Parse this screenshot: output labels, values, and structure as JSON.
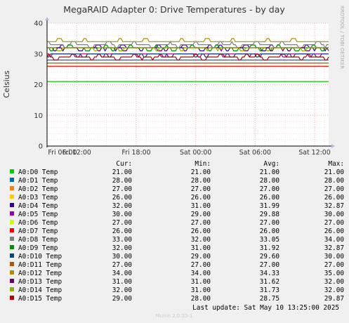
{
  "chart_data": {
    "type": "line",
    "title": "MegaRAID Adapter 0: Drive Temperatures - by day",
    "ylabel": "Celsius",
    "xlabel": "",
    "ylim": [
      0,
      40
    ],
    "yticks": [
      0,
      10,
      20,
      30,
      40
    ],
    "xrange": [
      "2025-05-09 09:00",
      "2025-05-10 13:25"
    ],
    "xticks": [
      {
        "label": "Fri 06:00",
        "t": "2025-05-09 06:00"
      },
      {
        "label": "Fri 12:00",
        "t": "2025-05-09 12:00"
      },
      {
        "label": "Fri 18:00",
        "t": "2025-05-09 18:00"
      },
      {
        "label": "Sat 00:00",
        "t": "2025-05-10 00:00"
      },
      {
        "label": "Sat 06:00",
        "t": "2025-05-10 06:00"
      },
      {
        "label": "Sat 12:00",
        "t": "2025-05-10 12:00"
      }
    ],
    "grid": true,
    "legend_position": "bottom",
    "columns": [
      "Cur:",
      "Min:",
      "Avg:",
      "Max:"
    ],
    "series": [
      {
        "name": "A0:D0 Temp",
        "color": "#00cc00",
        "cur": "21.00",
        "min": "21.00",
        "avg": "21.00",
        "max": "21.00"
      },
      {
        "name": "A0:D1 Temp",
        "color": "#0066b3",
        "cur": "28.00",
        "min": "28.00",
        "avg": "28.00",
        "max": "28.00"
      },
      {
        "name": "A0:D2 Temp",
        "color": "#ff8000",
        "cur": "27.00",
        "min": "27.00",
        "avg": "27.00",
        "max": "27.00"
      },
      {
        "name": "A0:D3 Temp",
        "color": "#ffcc00",
        "cur": "26.00",
        "min": "26.00",
        "avg": "26.00",
        "max": "26.00"
      },
      {
        "name": "A0:D4 Temp",
        "color": "#330099",
        "cur": "32.00",
        "min": "31.00",
        "avg": "31.99",
        "max": "32.87"
      },
      {
        "name": "A0:D5 Temp",
        "color": "#990099",
        "cur": "30.00",
        "min": "29.00",
        "avg": "29.88",
        "max": "30.00"
      },
      {
        "name": "A0:D6 Temp",
        "color": "#ccff00",
        "cur": "27.00",
        "min": "27.00",
        "avg": "27.00",
        "max": "27.00"
      },
      {
        "name": "A0:D7 Temp",
        "color": "#ff0000",
        "cur": "26.00",
        "min": "26.00",
        "avg": "26.00",
        "max": "26.00"
      },
      {
        "name": "A0:D8 Temp",
        "color": "#808080",
        "cur": "33.00",
        "min": "32.00",
        "avg": "33.05",
        "max": "34.00"
      },
      {
        "name": "A0:D9 Temp",
        "color": "#008f00",
        "cur": "32.00",
        "min": "31.00",
        "avg": "31.92",
        "max": "32.87"
      },
      {
        "name": "A0:D10 Temp",
        "color": "#00487d",
        "cur": "30.00",
        "min": "29.00",
        "avg": "29.60",
        "max": "30.00"
      },
      {
        "name": "A0:D11 Temp",
        "color": "#b35a00",
        "cur": "27.00",
        "min": "27.00",
        "avg": "27.00",
        "max": "27.00"
      },
      {
        "name": "A0:D12 Temp",
        "color": "#b38f00",
        "cur": "34.00",
        "min": "34.00",
        "avg": "34.33",
        "max": "35.00"
      },
      {
        "name": "A0:D13 Temp",
        "color": "#6b006b",
        "cur": "31.00",
        "min": "31.00",
        "avg": "31.62",
        "max": "32.00"
      },
      {
        "name": "A0:D14 Temp",
        "color": "#8fb300",
        "cur": "32.00",
        "min": "31.00",
        "avg": "31.73",
        "max": "32.00"
      },
      {
        "name": "A0:D15 Temp",
        "color": "#b30000",
        "cur": "29.00",
        "min": "28.00",
        "avg": "28.75",
        "max": "29.87"
      }
    ]
  },
  "side_label": "RRDTOOL / TOBI OETIKER",
  "last_update": "Last update:  Sat May 10 13:25:00 2025",
  "footer": "Munin 2.0.33-1"
}
